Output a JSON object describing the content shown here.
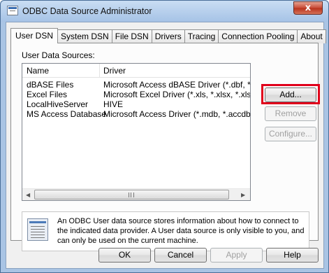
{
  "window": {
    "title": "ODBC Data Source Administrator",
    "close_glyph": "x"
  },
  "tabs": [
    {
      "label": "User DSN",
      "active": true
    },
    {
      "label": "System DSN"
    },
    {
      "label": "File DSN"
    },
    {
      "label": "Drivers"
    },
    {
      "label": "Tracing"
    },
    {
      "label": "Connection Pooling"
    },
    {
      "label": "About"
    }
  ],
  "user_dsn": {
    "section_label": "User Data Sources:",
    "columns": [
      "Name",
      "Driver"
    ],
    "rows": [
      {
        "name": "dBASE Files",
        "driver": "Microsoft Access dBASE Driver (*.dbf, *.ndx"
      },
      {
        "name": "Excel Files",
        "driver": "Microsoft Excel Driver (*.xls, *.xlsx, *.xlsm, *.xl"
      },
      {
        "name": "LocalHiveServer",
        "driver": "HIVE"
      },
      {
        "name": "MS Access Database",
        "driver": "Microsoft Access Driver (*.mdb, *.accdb)"
      }
    ],
    "scroll": {
      "left_arrow": "◀",
      "right_arrow": "▶"
    },
    "buttons": {
      "add": "Add...",
      "remove": "Remove",
      "configure": "Configure..."
    },
    "info_text": "An ODBC User data source stores information about how to connect to the indicated data provider.  A User data source is only visible to you, and can only be used on the current machine."
  },
  "dialog_buttons": {
    "ok": "OK",
    "cancel": "Cancel",
    "apply": "Apply",
    "help": "Help"
  },
  "colors": {
    "highlight_box": "#e0001b",
    "close_button": "#c84a35"
  },
  "icons": {
    "app": "odbc-app-icon",
    "info": "data-source-icon"
  }
}
